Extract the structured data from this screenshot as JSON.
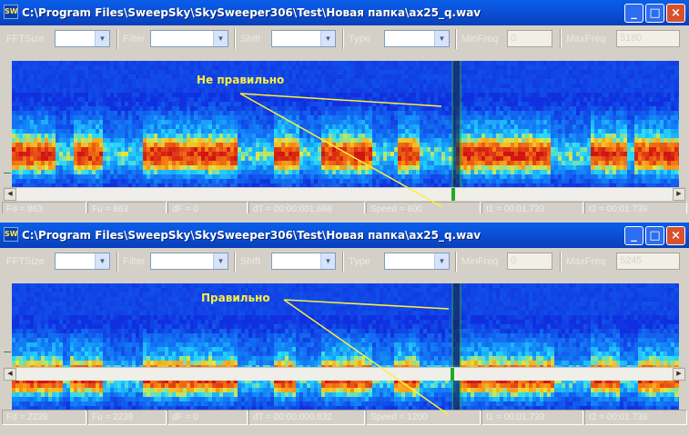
{
  "windows": [
    {
      "title": "C:\\Program Files\\SweepSky\\SkySweeper306\\Test\\Новая папка\\ax25_q.wav",
      "app_icon_text": "SW",
      "toolbar": {
        "fftsize_label": "FFTSize",
        "filter_label": "Filter",
        "shift_label": "Shift",
        "type_label": "Type",
        "minfreq_label": "MinFreq",
        "minfreq_value": "0",
        "maxfreq_label": "MaxFreq",
        "maxfreq_value": "5180"
      },
      "annotation": "Не правильно",
      "status": [
        "Fd = 863",
        "Fu = 863",
        "dF = 0",
        "dT = 00:00:001.668",
        "Speed = 600",
        "t1 = 00:01.733",
        "t2 = 00:01.739"
      ]
    },
    {
      "title": "C:\\Program Files\\SweepSky\\SkySweeper306\\Test\\Новая папка\\ax25_q.wav",
      "app_icon_text": "SW",
      "toolbar": {
        "fftsize_label": "FFTSize",
        "filter_label": "Filter",
        "shift_label": "Shift",
        "type_label": "Type",
        "minfreq_label": "MinFreq",
        "minfreq_value": "0",
        "maxfreq_label": "MaxFreq",
        "maxfreq_value": "5245"
      },
      "annotation": "Правильно",
      "status": [
        "Fd = 2239",
        "Fu = 2239",
        "dF = 0",
        "dT = 00:00:000.832",
        "Speed = 1200",
        "t1 = 00:01.733",
        "t2 = 00:01.739"
      ]
    }
  ],
  "title_buttons": {
    "minimize": "_",
    "maximize": "□",
    "close": "×"
  },
  "colors": {
    "titlebar": "#0a4fd6",
    "spectrogram_low": "#1030e0",
    "spectrogram_high": "#cc1010",
    "annotation": "#ffee40",
    "cursor": "#22aa22"
  }
}
